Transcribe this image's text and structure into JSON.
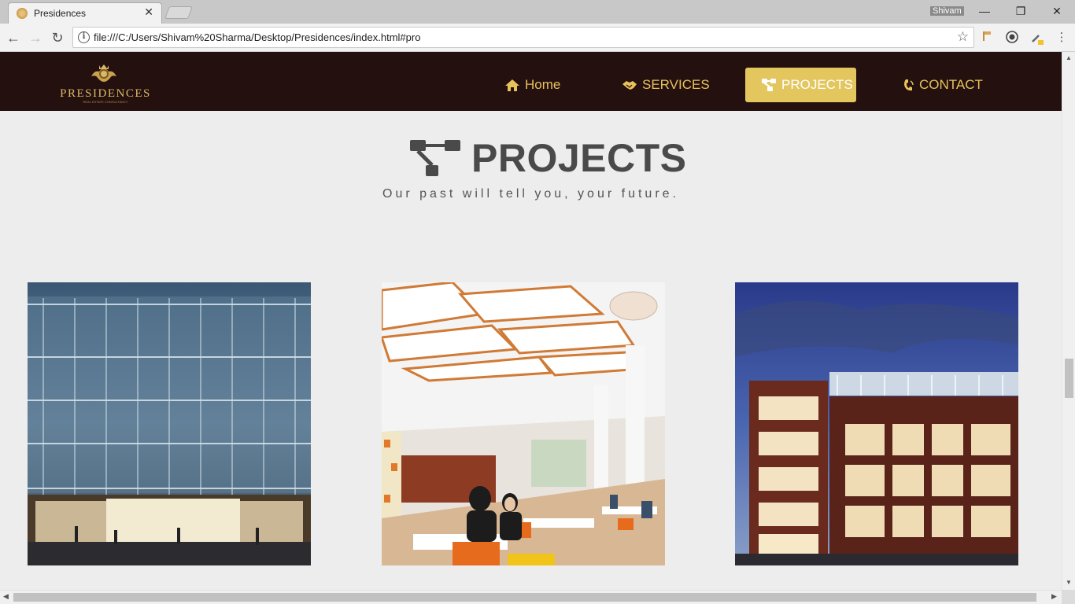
{
  "browser": {
    "tab_title": "Presidences",
    "tab_close": "✕",
    "user": "Shivam",
    "url": "file:///C:/Users/Shivam%20Sharma/Desktop/Presidences/index.html#pro",
    "minimize": "—",
    "restore": "❐",
    "close": "✕"
  },
  "site": {
    "logo_text": "PRESIDENCES",
    "logo_sub": "REAL ESTATE CONSULTANCY"
  },
  "menu": {
    "home": "Home",
    "services": "SERVICES",
    "projects": "PROJECTS",
    "contact": "CONTACT"
  },
  "section": {
    "title": "PROJECTS",
    "tagline": "Our past will tell you, your future."
  },
  "projects": [
    {
      "alt": "Glass facade office building at dusk"
    },
    {
      "alt": "Cafeteria interior with white ceiling panels"
    },
    {
      "alt": "Brick office building at twilight"
    }
  ],
  "colors": {
    "nav_bg": "#251010",
    "accent": "#e4c65f",
    "menu_text": "#e8c25a",
    "page_bg": "#ededed"
  }
}
